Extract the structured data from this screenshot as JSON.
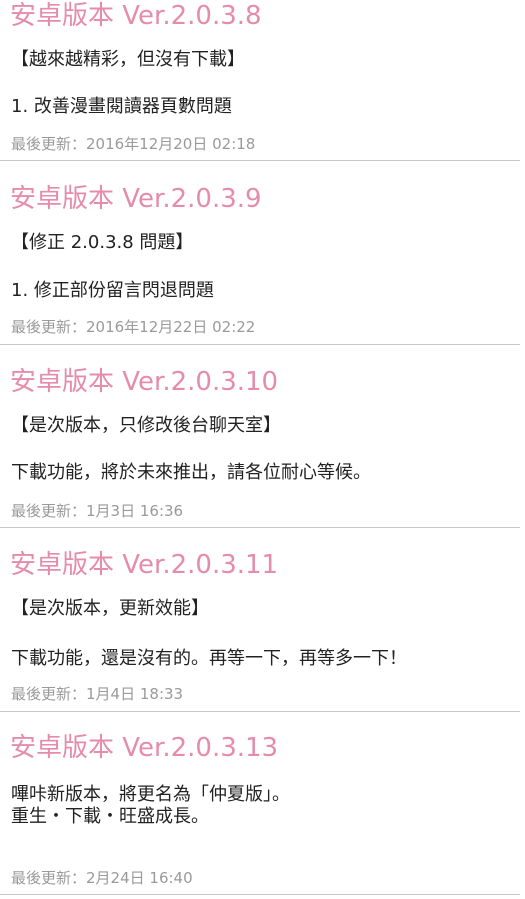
{
  "changelog": {
    "entries": [
      {
        "version": "安卓版本 Ver.2.0.3.8",
        "headline": "【越來越精彩，但沒有下載】",
        "body_lines": [
          "1. 改善漫畫閱讀器頁數問題"
        ],
        "updated": "最後更新：2016年12月20日 02:18"
      },
      {
        "version": "安卓版本 Ver.2.0.3.9",
        "headline": "【修正 2.0.3.8 問題】",
        "body_lines": [
          "1. 修正部份留言閃退問題"
        ],
        "updated": "最後更新：2016年12月22日 02:22"
      },
      {
        "version": "安卓版本 Ver.2.0.3.10",
        "headline": "【是次版本，只修改後台聊天室】",
        "body_lines": [
          "下載功能，將於未來推出，請各位耐心等候。"
        ],
        "updated": "最後更新：1月3日 16:36"
      },
      {
        "version": "安卓版本 Ver.2.0.3.11",
        "headline": "【是次版本，更新效能】",
        "body_lines": [
          "下載功能，還是沒有的。再等一下，再等多一下！"
        ],
        "updated": "最後更新：1月4日 18:33"
      },
      {
        "version": "安卓版本 Ver.2.0.3.13",
        "headline": "",
        "body_lines": [
          "嗶咔新版本，將更名為「仲夏版」。",
          "重生・下載・旺盛成長。"
        ],
        "updated": "最後更新：2月24日 16:40"
      }
    ]
  },
  "colors": {
    "version_title": "#e68cab",
    "body_text": "#222222",
    "updated_text": "#9a9a9a",
    "divider": "#c8c8c8"
  }
}
